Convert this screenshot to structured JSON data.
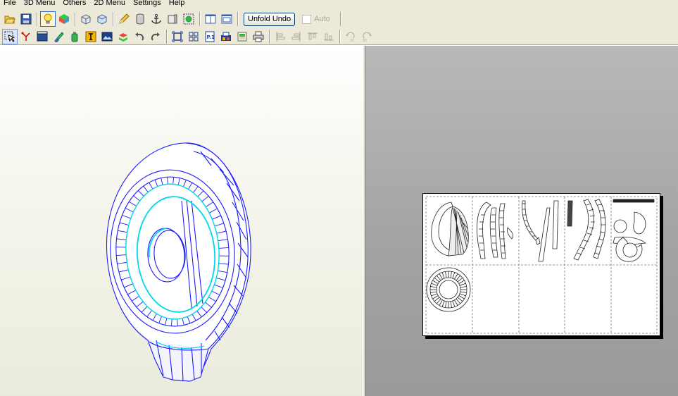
{
  "menu": {
    "items": [
      "File",
      "3D Menu",
      "Others",
      "2D Menu",
      "Settings",
      "Help"
    ]
  },
  "toolbar1": {
    "unfold_undo_label": "Unfold Undo",
    "auto_label": "Auto",
    "auto_checked": false
  },
  "colors": {
    "wire_blue": "#1a1aff",
    "wire_cyan": "#00d8e8",
    "view3d_bg": "#f4f4ea",
    "view2d_bg": "#a8a8a8"
  },
  "icons": {
    "row1": [
      "open-folder-icon",
      "save-icon",
      "lightbulb-icon",
      "color-cube-icon",
      "box-icon",
      "box-flat-icon",
      "pencil-icon",
      "cylinder-icon",
      "anchor-icon",
      "panel-icon",
      "globe-box-icon",
      "window-single-icon",
      "window-split-icon"
    ],
    "row2": [
      "select-arrow-icon",
      "edge-tool-icon",
      "clapper-icon",
      "brush-icon",
      "bottle-icon",
      "text-tool-icon",
      "image-icon",
      "join-icon",
      "undo-curve-icon",
      "redo-curve-icon",
      "fit-page-icon",
      "layout-icon",
      "page-number-icon",
      "print-setup-icon",
      "export-icon",
      "print-icon",
      "align-left-icon",
      "align-right-icon",
      "align-top-icon",
      "align-bottom-icon",
      "rotate-90-ccw-icon",
      "rotate-90-cw-icon"
    ]
  }
}
